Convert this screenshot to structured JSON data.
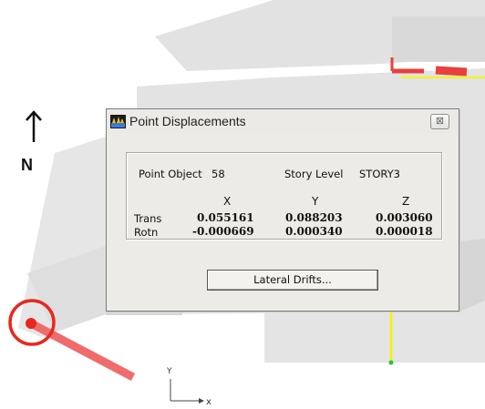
{
  "compass": {
    "north_label": "N"
  },
  "axes": {
    "x_label": "x",
    "y_label": "Y"
  },
  "dialog": {
    "title": "Point Displacements",
    "close_symbol": "⊠",
    "point_object_label": "Point Object",
    "point_object_value": "58",
    "story_level_label": "Story Level",
    "story_level_value": "STORY3",
    "columns": [
      "X",
      "Y",
      "Z"
    ],
    "rows": [
      {
        "label": "Trans",
        "values": [
          "0.055161",
          "0.088203",
          "0.003060"
        ]
      },
      {
        "label": "Rotn",
        "values": [
          "-0.000669",
          "0.000340",
          "0.000018"
        ]
      }
    ],
    "lateral_drifts_button": "Lateral Drifts..."
  },
  "colors": {
    "highlight_red": "#e8403d",
    "model_gray": "#e0e0e0",
    "yellow_line": "#f5f500"
  }
}
